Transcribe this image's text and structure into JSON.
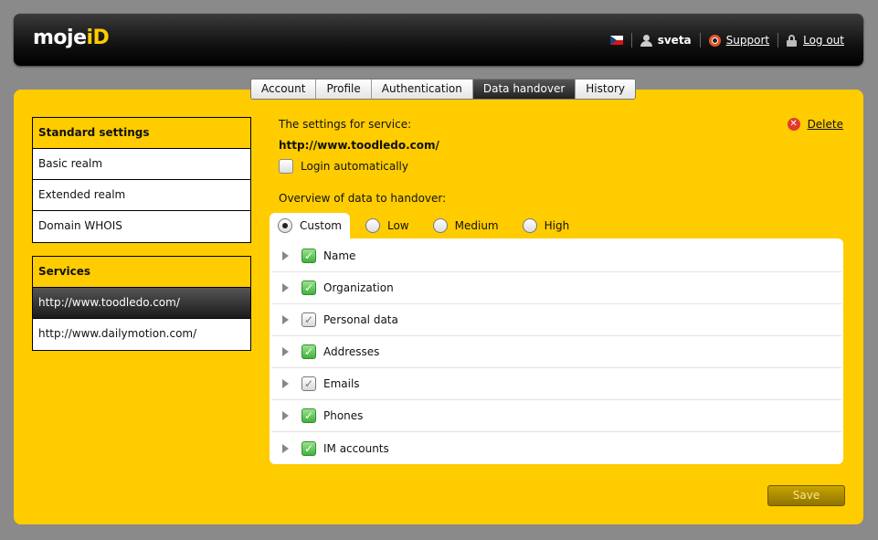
{
  "header": {
    "logo_main": "moje",
    "logo_accent": "iD",
    "username": "sveta",
    "support_label": "Support",
    "logout_label": "Log out"
  },
  "tabs": [
    {
      "label": "Account"
    },
    {
      "label": "Profile"
    },
    {
      "label": "Authentication"
    },
    {
      "label": "Data handover",
      "active": true
    },
    {
      "label": "History"
    }
  ],
  "sidebar": {
    "standard": {
      "title": "Standard settings",
      "items": [
        "Basic realm",
        "Extended realm",
        "Domain WHOIS"
      ]
    },
    "services": {
      "title": "Services",
      "items": [
        "http://www.toodledo.com/",
        "http://www.dailymotion.com/"
      ],
      "active_index": 0
    }
  },
  "content": {
    "settings_for_label": "The settings for service:",
    "service_url": "http://www.toodledo.com/",
    "login_auto_label": "Login automatically",
    "login_auto_checked": false,
    "delete_label": "Delete",
    "overview_label": "Overview of data to handover:",
    "levels": [
      {
        "label": "Custom",
        "selected": true
      },
      {
        "label": "Low",
        "selected": false
      },
      {
        "label": "Medium",
        "selected": false
      },
      {
        "label": "High",
        "selected": false
      }
    ],
    "data_items": [
      {
        "label": "Name",
        "state": "checked"
      },
      {
        "label": "Organization",
        "state": "checked"
      },
      {
        "label": "Personal data",
        "state": "partial"
      },
      {
        "label": "Addresses",
        "state": "checked"
      },
      {
        "label": "Emails",
        "state": "partial"
      },
      {
        "label": "Phones",
        "state": "checked"
      },
      {
        "label": "IM accounts",
        "state": "checked"
      }
    ],
    "save_label": "Save"
  },
  "colors": {
    "brand_yellow": "#ffcc00",
    "header_dark": "#111111",
    "check_green": "#3db33a"
  }
}
